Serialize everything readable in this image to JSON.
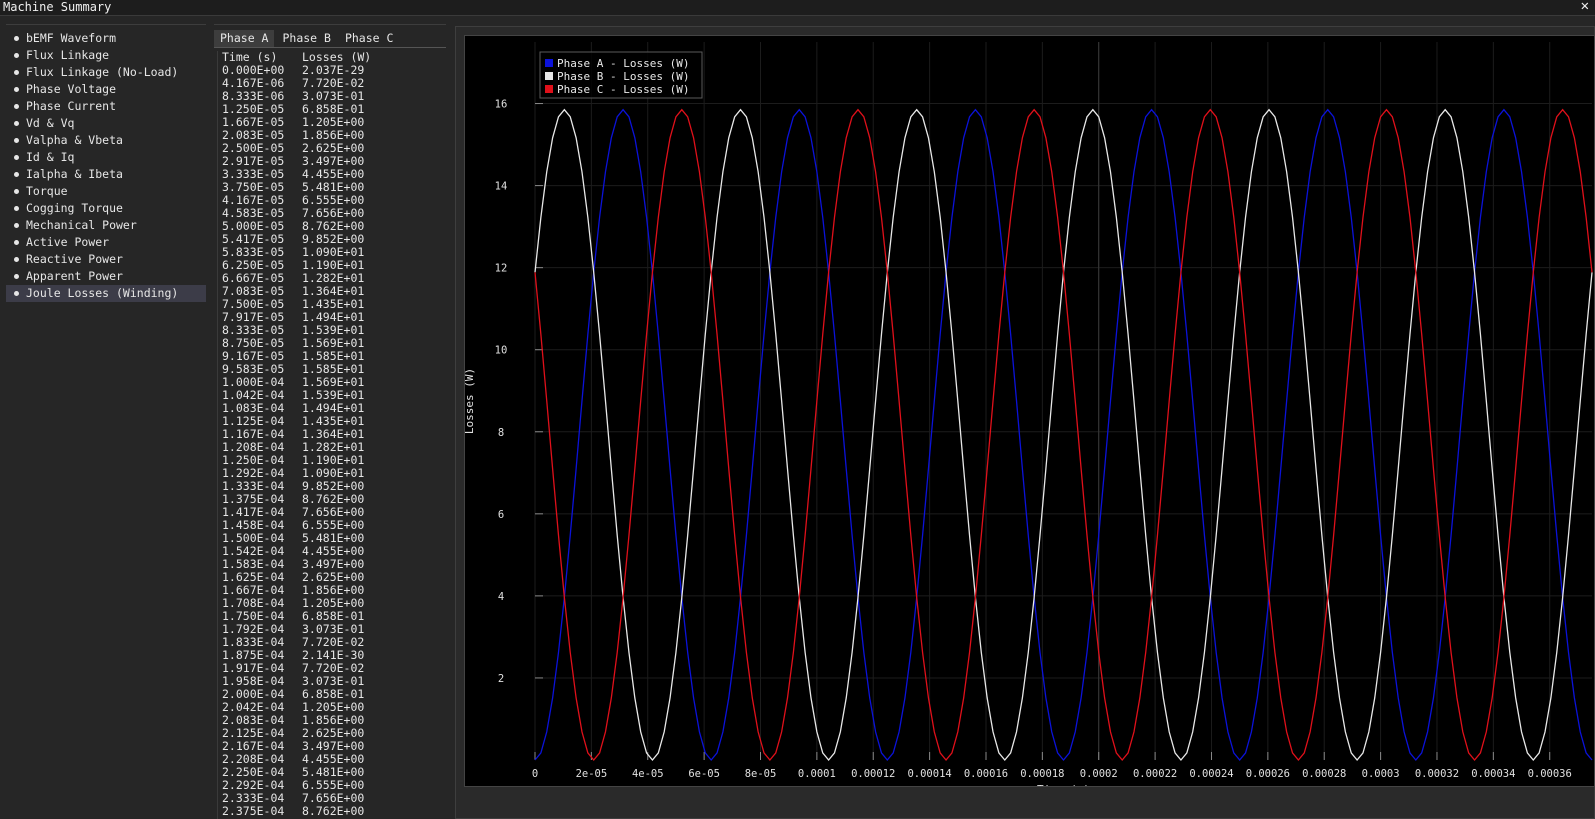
{
  "window": {
    "title": "Machine Summary",
    "close_glyph": "✕"
  },
  "sidebar": {
    "items": [
      {
        "label": "bEMF Waveform",
        "active": false
      },
      {
        "label": "Flux Linkage",
        "active": false
      },
      {
        "label": "Flux Linkage (No-Load)",
        "active": false
      },
      {
        "label": "Phase Voltage",
        "active": false
      },
      {
        "label": "Phase Current",
        "active": false
      },
      {
        "label": "Vd & Vq",
        "active": false
      },
      {
        "label": "Valpha & Vbeta",
        "active": false
      },
      {
        "label": "Id & Iq",
        "active": false
      },
      {
        "label": "Ialpha & Ibeta",
        "active": false
      },
      {
        "label": "Torque",
        "active": false
      },
      {
        "label": "Cogging Torque",
        "active": false
      },
      {
        "label": "Mechanical Power",
        "active": false
      },
      {
        "label": "Active Power",
        "active": false
      },
      {
        "label": "Reactive Power",
        "active": false
      },
      {
        "label": "Apparent Power",
        "active": false
      },
      {
        "label": "Joule Losses (Winding)",
        "active": true
      }
    ]
  },
  "table": {
    "tabs": [
      {
        "label": "Phase A",
        "active": true
      },
      {
        "label": "Phase B",
        "active": false
      },
      {
        "label": "Phase C",
        "active": false
      }
    ],
    "headers": [
      "Time (s)",
      "Losses (W)"
    ],
    "rows": [
      [
        "0.000E+00",
        "2.037E-29"
      ],
      [
        "4.167E-06",
        "7.720E-02"
      ],
      [
        "8.333E-06",
        "3.073E-01"
      ],
      [
        "1.250E-05",
        "6.858E-01"
      ],
      [
        "1.667E-05",
        "1.205E+00"
      ],
      [
        "2.083E-05",
        "1.856E+00"
      ],
      [
        "2.500E-05",
        "2.625E+00"
      ],
      [
        "2.917E-05",
        "3.497E+00"
      ],
      [
        "3.333E-05",
        "4.455E+00"
      ],
      [
        "3.750E-05",
        "5.481E+00"
      ],
      [
        "4.167E-05",
        "6.555E+00"
      ],
      [
        "4.583E-05",
        "7.656E+00"
      ],
      [
        "5.000E-05",
        "8.762E+00"
      ],
      [
        "5.417E-05",
        "9.852E+00"
      ],
      [
        "5.833E-05",
        "1.090E+01"
      ],
      [
        "6.250E-05",
        "1.190E+01"
      ],
      [
        "6.667E-05",
        "1.282E+01"
      ],
      [
        "7.083E-05",
        "1.364E+01"
      ],
      [
        "7.500E-05",
        "1.435E+01"
      ],
      [
        "7.917E-05",
        "1.494E+01"
      ],
      [
        "8.333E-05",
        "1.539E+01"
      ],
      [
        "8.750E-05",
        "1.569E+01"
      ],
      [
        "9.167E-05",
        "1.585E+01"
      ],
      [
        "9.583E-05",
        "1.585E+01"
      ],
      [
        "1.000E-04",
        "1.569E+01"
      ],
      [
        "1.042E-04",
        "1.539E+01"
      ],
      [
        "1.083E-04",
        "1.494E+01"
      ],
      [
        "1.125E-04",
        "1.435E+01"
      ],
      [
        "1.167E-04",
        "1.364E+01"
      ],
      [
        "1.208E-04",
        "1.282E+01"
      ],
      [
        "1.250E-04",
        "1.190E+01"
      ],
      [
        "1.292E-04",
        "1.090E+01"
      ],
      [
        "1.333E-04",
        "9.852E+00"
      ],
      [
        "1.375E-04",
        "8.762E+00"
      ],
      [
        "1.417E-04",
        "7.656E+00"
      ],
      [
        "1.458E-04",
        "6.555E+00"
      ],
      [
        "1.500E-04",
        "5.481E+00"
      ],
      [
        "1.542E-04",
        "4.455E+00"
      ],
      [
        "1.583E-04",
        "3.497E+00"
      ],
      [
        "1.625E-04",
        "2.625E+00"
      ],
      [
        "1.667E-04",
        "1.856E+00"
      ],
      [
        "1.708E-04",
        "1.205E+00"
      ],
      [
        "1.750E-04",
        "6.858E-01"
      ],
      [
        "1.792E-04",
        "3.073E-01"
      ],
      [
        "1.833E-04",
        "7.720E-02"
      ],
      [
        "1.875E-04",
        "2.141E-30"
      ],
      [
        "1.917E-04",
        "7.720E-02"
      ],
      [
        "1.958E-04",
        "3.073E-01"
      ],
      [
        "2.000E-04",
        "6.858E-01"
      ],
      [
        "2.042E-04",
        "1.205E+00"
      ],
      [
        "2.083E-04",
        "1.856E+00"
      ],
      [
        "2.125E-04",
        "2.625E+00"
      ],
      [
        "2.167E-04",
        "3.497E+00"
      ],
      [
        "2.208E-04",
        "4.455E+00"
      ],
      [
        "2.250E-04",
        "5.481E+00"
      ],
      [
        "2.292E-04",
        "6.555E+00"
      ],
      [
        "2.333E-04",
        "7.656E+00"
      ],
      [
        "2.375E-04",
        "8.762E+00"
      ]
    ]
  },
  "chart_data": {
    "type": "line",
    "title": "",
    "xlabel": "Time (s)",
    "ylabel": "Losses (W)",
    "xlim": [
      0,
      0.000375
    ],
    "ylim": [
      0,
      17.5
    ],
    "x_ticks": [
      "0",
      "2e-05",
      "4e-05",
      "6e-05",
      "8e-05",
      "0.0001",
      "0.00012",
      "0.00014",
      "0.00016",
      "0.00018",
      "0.0002",
      "0.00022",
      "0.00024",
      "0.00026",
      "0.00028",
      "0.0003",
      "0.00032",
      "0.00034",
      "0.00036"
    ],
    "x_tick_values": [
      0,
      2e-05,
      4e-05,
      6e-05,
      8e-05,
      0.0001,
      0.00012,
      0.00014,
      0.00016,
      0.00018,
      0.0002,
      0.00022,
      0.00024,
      0.00026,
      0.00028,
      0.0003,
      0.00032,
      0.00034,
      0.00036
    ],
    "y_ticks": [
      "2",
      "4",
      "6",
      "8",
      "10",
      "12",
      "14",
      "16"
    ],
    "y_tick_values": [
      2,
      4,
      6,
      8,
      10,
      12,
      14,
      16
    ],
    "grid": true,
    "legend_position": "top-left",
    "sampling": {
      "period": 0.000125,
      "peak": 15.85,
      "x_max": 0.000375,
      "step": 2.08333e-06
    },
    "series": [
      {
        "name": "Phase A - Losses (W)",
        "color": "#0b12d9",
        "phase_deg": 0
      },
      {
        "name": "Phase B - Losses (W)",
        "color": "#e8e8e8",
        "phase_deg": -120
      },
      {
        "name": "Phase C - Losses (W)",
        "color": "#e0101a",
        "phase_deg": 120
      }
    ]
  }
}
